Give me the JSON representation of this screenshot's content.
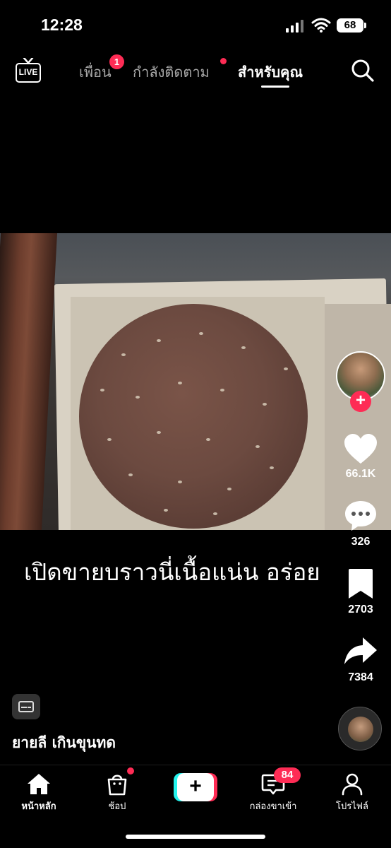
{
  "status_bar": {
    "time": "12:28",
    "battery": "68"
  },
  "top_nav": {
    "live_label": "LIVE",
    "tabs": [
      {
        "label": "เพื่อน",
        "badge": "1"
      },
      {
        "label": "กำลังติดตาม"
      },
      {
        "label": "สำหรับคุณ",
        "active": true
      }
    ]
  },
  "video": {
    "caption": "เปิดขายบราวนี่เนื้อแน่น อร่อย"
  },
  "right_rail": {
    "follow_symbol": "+",
    "likes": "66.1K",
    "comments": "326",
    "saves": "2703",
    "shares": "7384"
  },
  "author": {
    "username": "ยายลี เกินขุนทด"
  },
  "bottom_nav": {
    "items": [
      {
        "label": "หน้าหลัก",
        "icon": "home-icon"
      },
      {
        "label": "ช้อป",
        "icon": "shopping-bag-icon"
      },
      {
        "label": "+",
        "icon": "create-icon"
      },
      {
        "label": "กล่องขาเข้า",
        "icon": "inbox-icon",
        "badge": "84"
      },
      {
        "label": "โปรไฟล์",
        "icon": "profile-icon"
      }
    ]
  },
  "colors": {
    "accent": "#fe2c55",
    "cyan": "#25f4ee",
    "background": "#000000"
  }
}
